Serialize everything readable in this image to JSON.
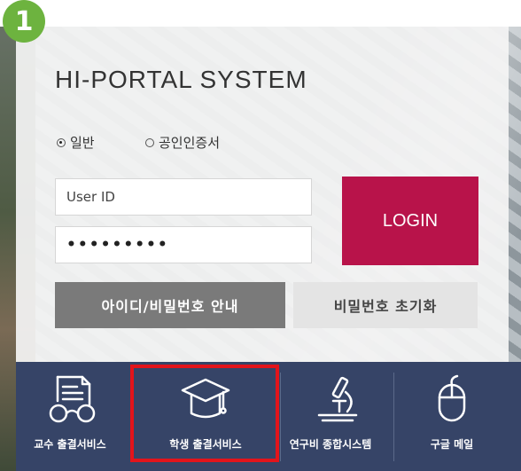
{
  "step": {
    "number": "1"
  },
  "portal": {
    "title": "HI-PORTAL SYSTEM"
  },
  "auth": {
    "options": [
      {
        "label": "일반",
        "checked": true
      },
      {
        "label": "공인인증서",
        "checked": false
      }
    ]
  },
  "login": {
    "user_id_value": "User ID",
    "password_value": "•••••••••",
    "button_label": "LOGIN"
  },
  "links": {
    "id_pw_guide": "아이디/비밀번호 안내",
    "pw_reset": "비밀번호 초기화"
  },
  "services": [
    {
      "label": "교수 출결서비스",
      "icon": "attendance-document-icon"
    },
    {
      "label": "학생 출결서비스",
      "icon": "graduation-cap-icon"
    },
    {
      "label": "연구비 종합시스템",
      "icon": "microscope-icon"
    },
    {
      "label": "구글 메일",
      "icon": "mouse-icon"
    }
  ],
  "colors": {
    "login_button": "#b8134a",
    "service_bar": "#364467",
    "highlight": "#e3141b",
    "step_badge": "#6db33f"
  }
}
